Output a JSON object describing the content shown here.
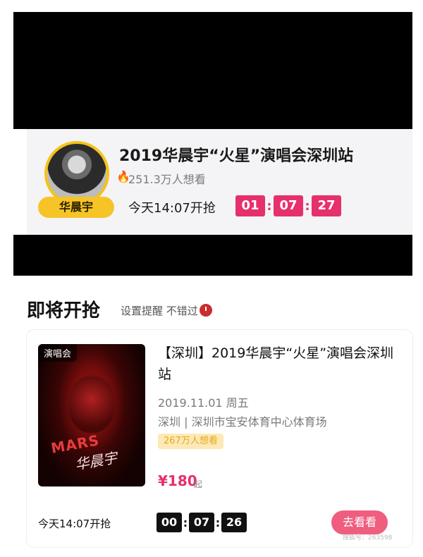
{
  "banner": {
    "artist_name": "华晨宇",
    "title": "2019华晨宇“火星”演唱会深圳站",
    "heat_text": "251.3万人想看",
    "start_text": "今天14:07开抢",
    "countdown": [
      "01",
      "07",
      "27"
    ],
    "accent_color": "#e6306b",
    "pill_color": "#f6c426"
  },
  "section": {
    "title": "即将开抢",
    "subtitle": "设置提醒 不错过"
  },
  "card": {
    "poster_tag": "演唱会",
    "poster_art_text": "MARS",
    "poster_signature": "华晨宇",
    "title": "【深圳】2019华晨宇“火星”演唱会深圳站",
    "date": "2019.11.01 周五",
    "venue": "深圳 | 深圳市宝安体育中心体育场",
    "badge": "267万人想看",
    "price": "¥180",
    "price_suffix": "起",
    "start_text": "今天14:07开抢",
    "countdown": [
      "00",
      "07",
      "26"
    ],
    "button_label": "去看看",
    "watermark": "搜狐号：263598"
  },
  "icons": {
    "flame": "flame-icon",
    "clock": "alarm-clock-icon"
  }
}
